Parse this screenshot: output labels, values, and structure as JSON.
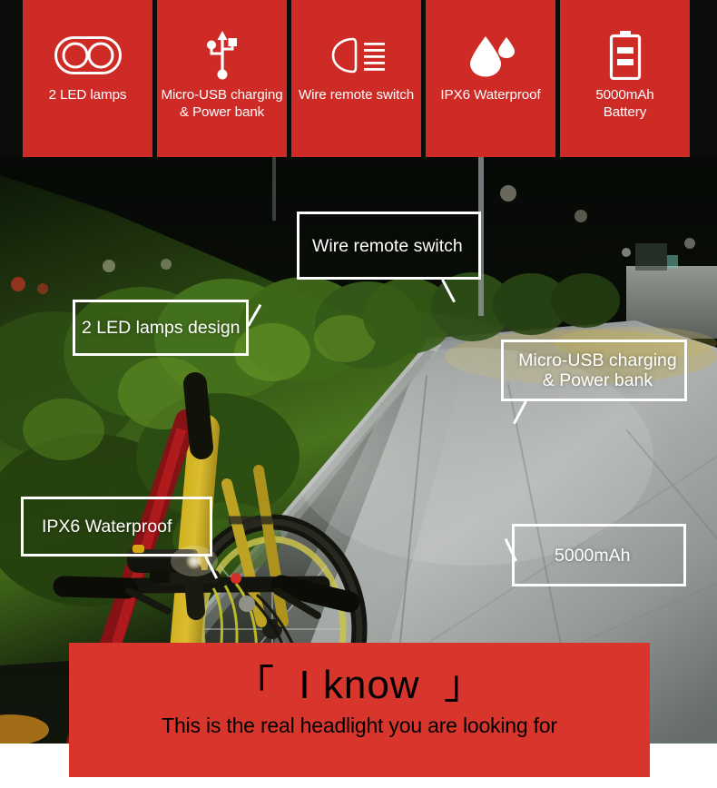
{
  "theme": {
    "brand_red": "#CE2A26",
    "banner_red": "#D8352C",
    "card_text": "#FFFFFF",
    "banner_text": "#000000",
    "callout_border": "#FFFFFF",
    "strip_background": "#0C0D0A"
  },
  "feature_strip": {
    "cards": [
      {
        "icon": "dual-led-lamp-icon",
        "label": "2 LED lamps"
      },
      {
        "icon": "micro-usb-icon",
        "label": "Micro-USB charging\n& Power bank"
      },
      {
        "icon": "wire-remote-switch-icon",
        "label": "Wire remote switch"
      },
      {
        "icon": "water-drop-icon",
        "label": "IPX6 Waterproof"
      },
      {
        "icon": "battery-icon",
        "label": "5000mAh\nBattery"
      }
    ]
  },
  "photo": {
    "alt": "Mountain bike with headlight mounted on handlebars on a lit night path beside hedges",
    "callouts": [
      {
        "id": "wire",
        "label": "Wire remote switch"
      },
      {
        "id": "led",
        "label": "2 LED lamps design"
      },
      {
        "id": "usb",
        "label": "Micro-USB charging\n& Power bank"
      },
      {
        "id": "ipx6",
        "label": "IPX6 Waterproof"
      },
      {
        "id": "mah",
        "label": "5000mAh"
      }
    ]
  },
  "bottom_banner": {
    "headline": "「  I know  」",
    "subtitle": "This is the real headlight you are looking for"
  }
}
